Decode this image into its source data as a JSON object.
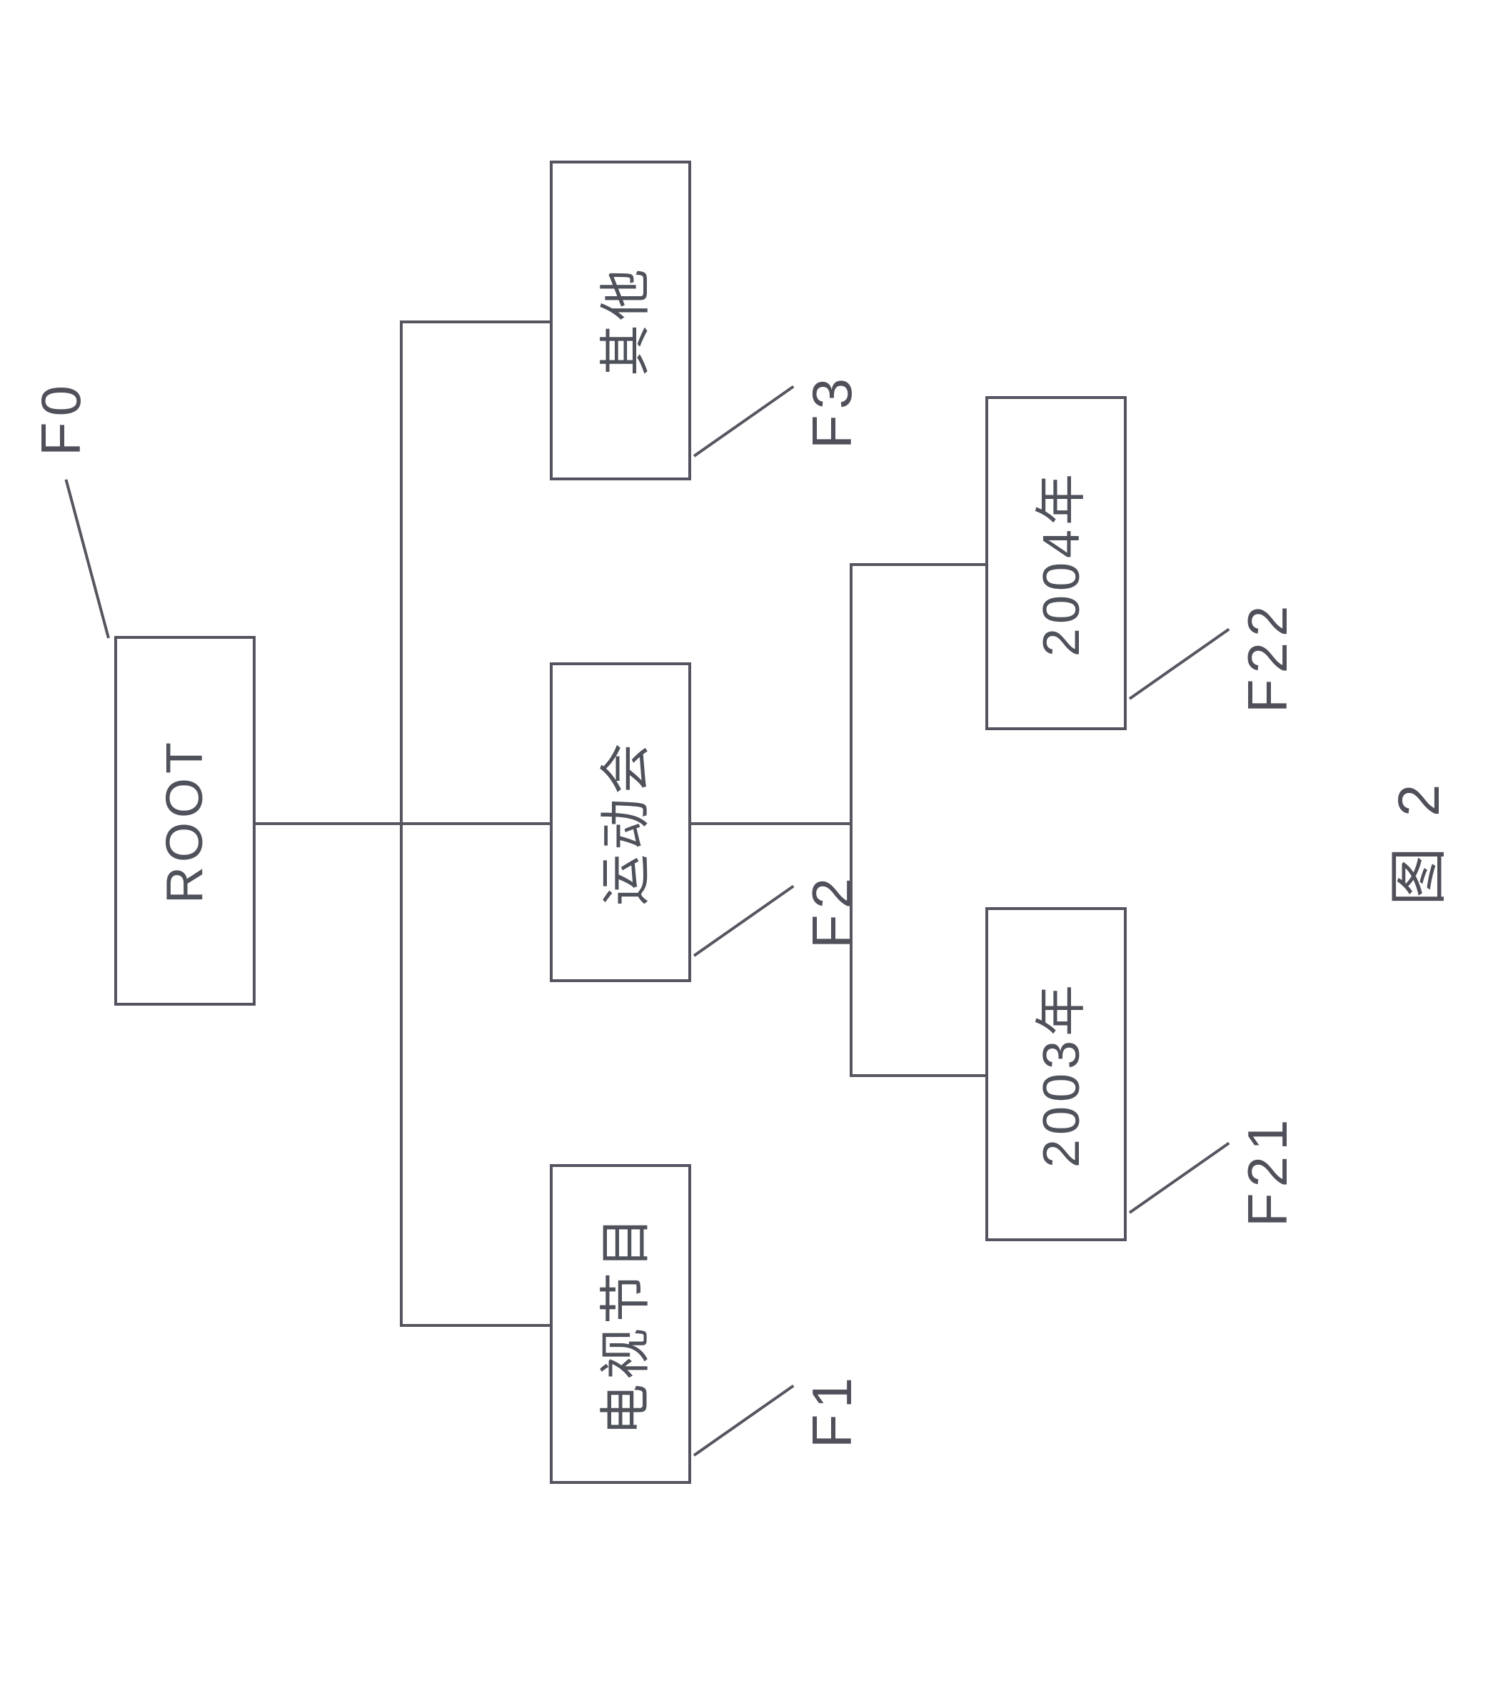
{
  "nodes": {
    "root": {
      "id": "F0",
      "text": "ROOT"
    },
    "n1": {
      "id": "F1",
      "text": "电视节目"
    },
    "n2": {
      "id": "F2",
      "text": "运动会"
    },
    "n3": {
      "id": "F3",
      "text": "其他"
    },
    "n21": {
      "id": "F21",
      "text": "2003年"
    },
    "n22": {
      "id": "F22",
      "text": "2004年"
    }
  },
  "caption": "图 2"
}
